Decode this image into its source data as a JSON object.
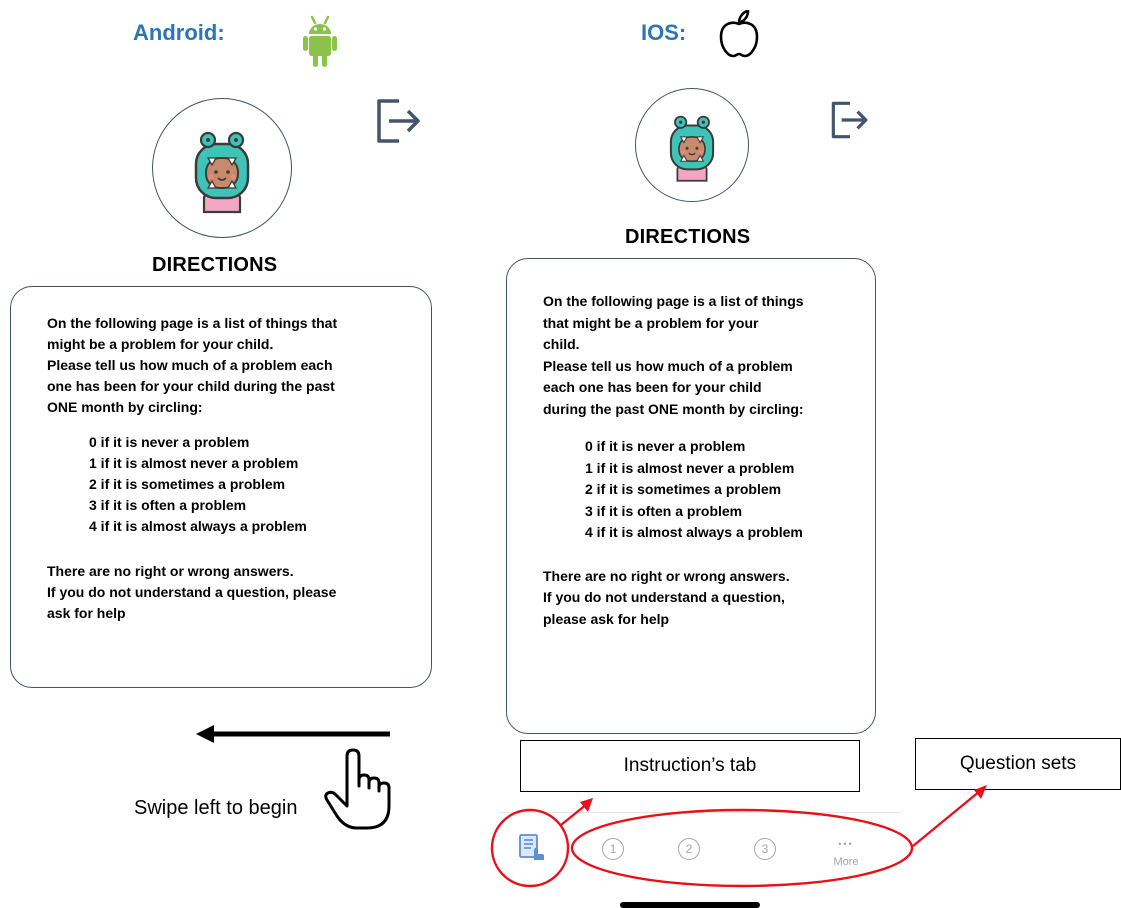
{
  "android": {
    "platform_label": "Android:",
    "platform_icon": "android-robot-icon",
    "directions_title": "DIRECTIONS",
    "intro_lines": [
      "On the following page is a list of things that",
      "might be a problem for your child.",
      "Please tell us how much of a problem each",
      "one has been for your child during the past",
      "ONE month by circling:"
    ],
    "scale": [
      "0 if it is never a problem",
      "1 if it is almost never a problem",
      "2 if it is sometimes a problem",
      "3 if it is often a problem",
      "4 if it is almost always a problem"
    ],
    "closing_lines": [
      "There are no right or wrong answers.",
      "If you do not understand a question, please",
      "ask for help"
    ],
    "swipe_text": "Swipe left to begin"
  },
  "ios": {
    "platform_label": "IOS:",
    "platform_icon": "apple-logo-icon",
    "directions_title": "DIRECTIONS",
    "intro_lines": [
      "On the following page is a list of things",
      "that might be a problem for your",
      "child.",
      "Please tell us how much of a problem",
      "each one has been for your child",
      "during the past ONE month by circling:"
    ],
    "scale": [
      "0 if it is never a problem",
      "1 if it is almost never a problem",
      "2 if it is sometimes a problem",
      "3 if it is often a problem",
      "4 if it is almost always a problem"
    ],
    "closing_lines": [
      "There are no right or wrong answers.",
      "If you do not understand a question,",
      "please ask for help"
    ],
    "tabs": [
      "1",
      "2",
      "3"
    ],
    "more_dots": "•••",
    "more_label": "More"
  },
  "annotations": {
    "instruction_tab": "Instruction’s tab",
    "question_sets": "Question sets"
  },
  "colors": {
    "platform_label": "#2e75b6",
    "android_green": "#8bc34a",
    "exit_icon": "#44546a",
    "annotation_red": "#e8101b",
    "tab_grey": "#a5a5a5",
    "instruction_icon_blue": "#5b8fd8"
  }
}
